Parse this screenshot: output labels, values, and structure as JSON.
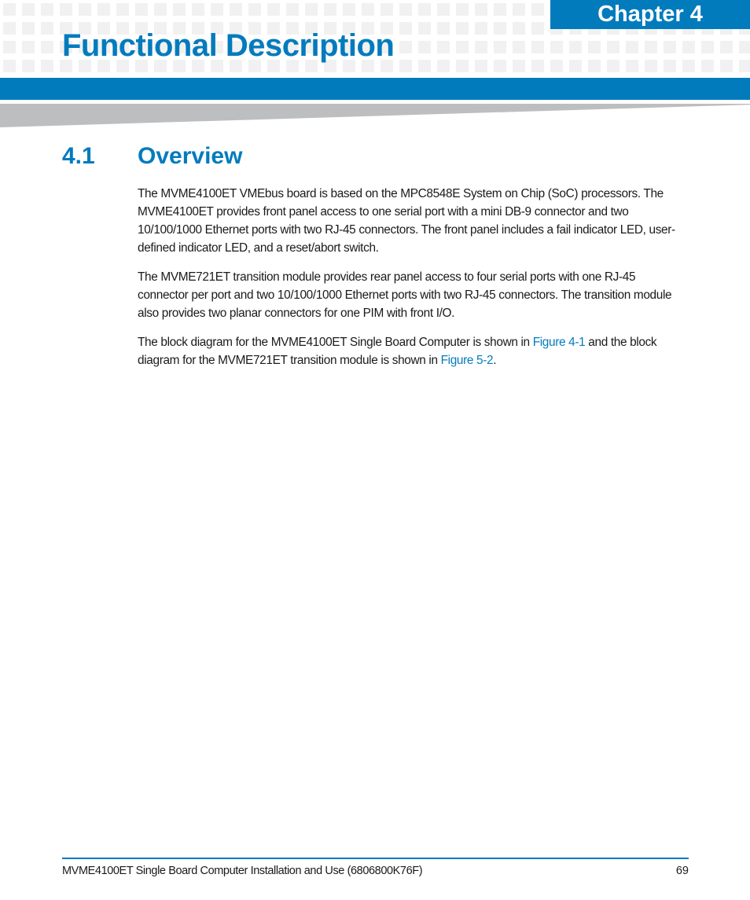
{
  "header": {
    "chapter_label": "Chapter 4",
    "chapter_title": "Functional Description"
  },
  "section": {
    "number": "4.1",
    "title": "Overview"
  },
  "paragraphs": {
    "p1": "The MVME4100ET VMEbus board is based on the MPC8548E System on Chip (SoC) processors. The MVME4100ET provides front panel access to one serial port with a mini DB-9 connector and two 10/100/1000 Ethernet ports with two RJ-45 connectors. The front panel includes a fail indicator LED, user-defined indicator LED, and a reset/abort switch.",
    "p2": "The MVME721ET transition module provides rear panel access to four serial ports with one RJ-45 connector per port and two 10/100/1000 Ethernet ports with two RJ-45 connectors. The transition module also provides two planar connectors for one PIM with front I/O.",
    "p3": {
      "part1": "The block diagram for the MVME4100ET Single Board Computer is shown in ",
      "link1": "Figure 4-1",
      "part2": " and the block diagram for the MVME721ET transition module is shown in ",
      "link2": "Figure 5-2",
      "part3": "."
    }
  },
  "footer": {
    "document_title": "MVME4100ET Single Board Computer Installation and Use (6806800K76F)",
    "page_number": "69"
  },
  "colors": {
    "accent": "#027bbd",
    "band_gray": "#bdbec0",
    "pattern_gray": "#f1f1f1"
  }
}
